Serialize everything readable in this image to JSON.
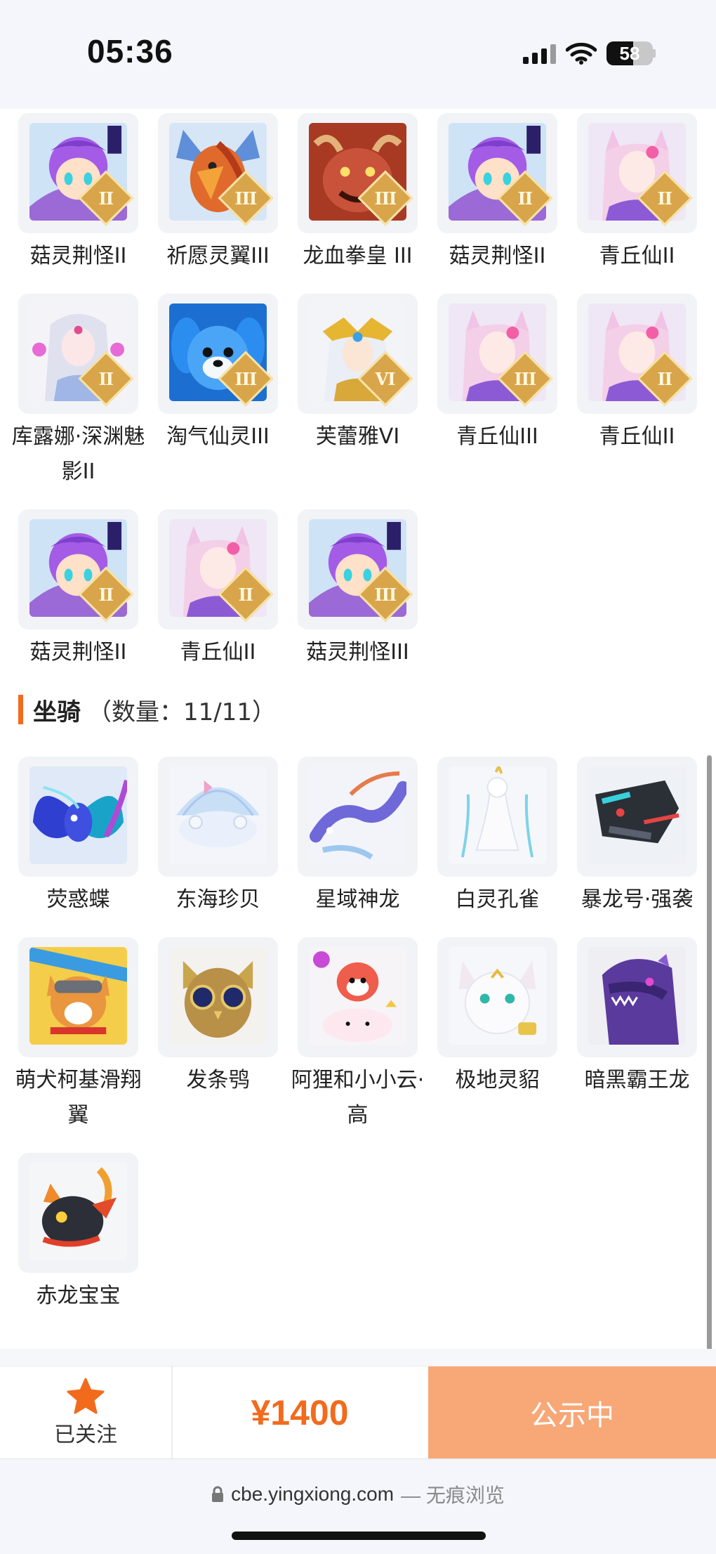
{
  "status_bar": {
    "time": "05:36",
    "battery": "58"
  },
  "characters": [
    {
      "name": "菇灵荆怪II",
      "grade": "II",
      "art": "mushroom"
    },
    {
      "name": "祈愿灵翼III",
      "grade": "III",
      "art": "bird"
    },
    {
      "name": "龙血拳皇 III",
      "grade": "III",
      "art": "dragon"
    },
    {
      "name": "菇灵荆怪II",
      "grade": "II",
      "art": "mushroom"
    },
    {
      "name": "青丘仙II",
      "grade": "II",
      "art": "fox"
    },
    {
      "name": "库露娜·深渊魅影II",
      "grade": "II",
      "art": "lady"
    },
    {
      "name": "淘气仙灵III",
      "grade": "III",
      "art": "pup"
    },
    {
      "name": "芙蕾雅VI",
      "grade": "VI",
      "art": "valkyrie"
    },
    {
      "name": "青丘仙III",
      "grade": "III",
      "art": "fox"
    },
    {
      "name": "青丘仙II",
      "grade": "II",
      "art": "fox"
    },
    {
      "name": "菇灵荆怪II",
      "grade": "II",
      "art": "mushroom"
    },
    {
      "name": "青丘仙II",
      "grade": "II",
      "art": "fox"
    },
    {
      "name": "菇灵荆怪III",
      "grade": "III",
      "art": "mushroom"
    }
  ],
  "mounts_section": {
    "title": "坐骑",
    "count": "（数量：11/11）"
  },
  "mounts": [
    {
      "name": "荧惑蝶",
      "art": "butterfly"
    },
    {
      "name": "东海珍贝",
      "art": "shell"
    },
    {
      "name": "星域神龙",
      "art": "stardragon"
    },
    {
      "name": "白灵孔雀",
      "art": "peacock"
    },
    {
      "name": "暴龙号·强袭",
      "art": "mecha"
    },
    {
      "name": "萌犬柯基滑翔翼",
      "art": "corgi"
    },
    {
      "name": "发条鸮",
      "art": "owl"
    },
    {
      "name": "阿狸和小小云·高",
      "art": "ali"
    },
    {
      "name": "极地灵貂",
      "art": "ferret"
    },
    {
      "name": "暗黑霸王龙",
      "art": "trex"
    },
    {
      "name": "赤龙宝宝",
      "art": "babydragon"
    }
  ],
  "action_bar": {
    "follow_label": "已关注",
    "price": "¥1400",
    "status_label": "公示中"
  },
  "browser": {
    "url": "cbe.yingxiong.com",
    "mode": "— 无痕浏览"
  },
  "colors": {
    "accent": "#f26b1d",
    "status_button": "#f8a777"
  },
  "icons": [
    "lock-icon",
    "star-icon",
    "wifi-icon",
    "signal-icon",
    "battery-icon"
  ]
}
